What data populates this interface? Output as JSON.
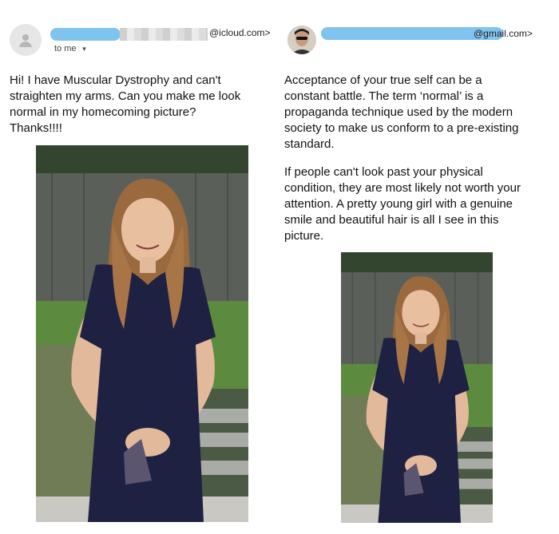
{
  "left_email": {
    "sender_domain": "@icloud.com>",
    "recipient_label": "to me",
    "message": [
      "Hi! I have Muscular Dystrophy and can't",
      "straighten my arms. Can you make me look",
      "normal in my homecoming picture?",
      "Thanks!!!!"
    ]
  },
  "right_email": {
    "sender_domain": "@gmail.com>",
    "paragraph1": [
      "Acceptance of your true self can be a",
      "constant battle. The term ‘normal’ is a",
      "propaganda technique used by the modern",
      "society to make us conform to a pre-existing",
      "standard."
    ],
    "paragraph2": [
      "If people can't look past your physical",
      "condition, they are most likely not worth your",
      "attention. A pretty young girl with a genuine",
      "smile and beautiful hair is all I see in this",
      "picture."
    ]
  },
  "colors": {
    "redaction": "#7fc3ef",
    "dress": "#1f2142",
    "hair": "#9a6a3e"
  },
  "icons": [
    "person-icon",
    "chevron-down-icon"
  ]
}
